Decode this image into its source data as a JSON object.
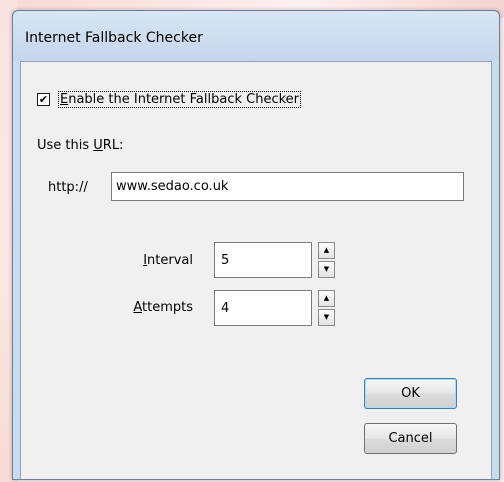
{
  "window": {
    "title": "Internet Fallback Checker"
  },
  "enable_checkbox": {
    "checked": true,
    "check_mark": "✔",
    "label_first": "E",
    "label_rest": "nable the Internet Fallback Checker"
  },
  "url_section": {
    "label_prefix": "Use this ",
    "label_mnemonic": "U",
    "label_suffix": "RL:",
    "scheme": "http://",
    "value": "www.sedao.co.uk"
  },
  "interval": {
    "label_first": "I",
    "label_rest": "nterval",
    "value": "5"
  },
  "attempts": {
    "label_first": "A",
    "label_rest": "ttempts",
    "value": "4"
  },
  "spinner": {
    "up_arrow": "▲",
    "down_arrow": "▼"
  },
  "buttons": {
    "ok": "OK",
    "cancel": "Cancel"
  }
}
